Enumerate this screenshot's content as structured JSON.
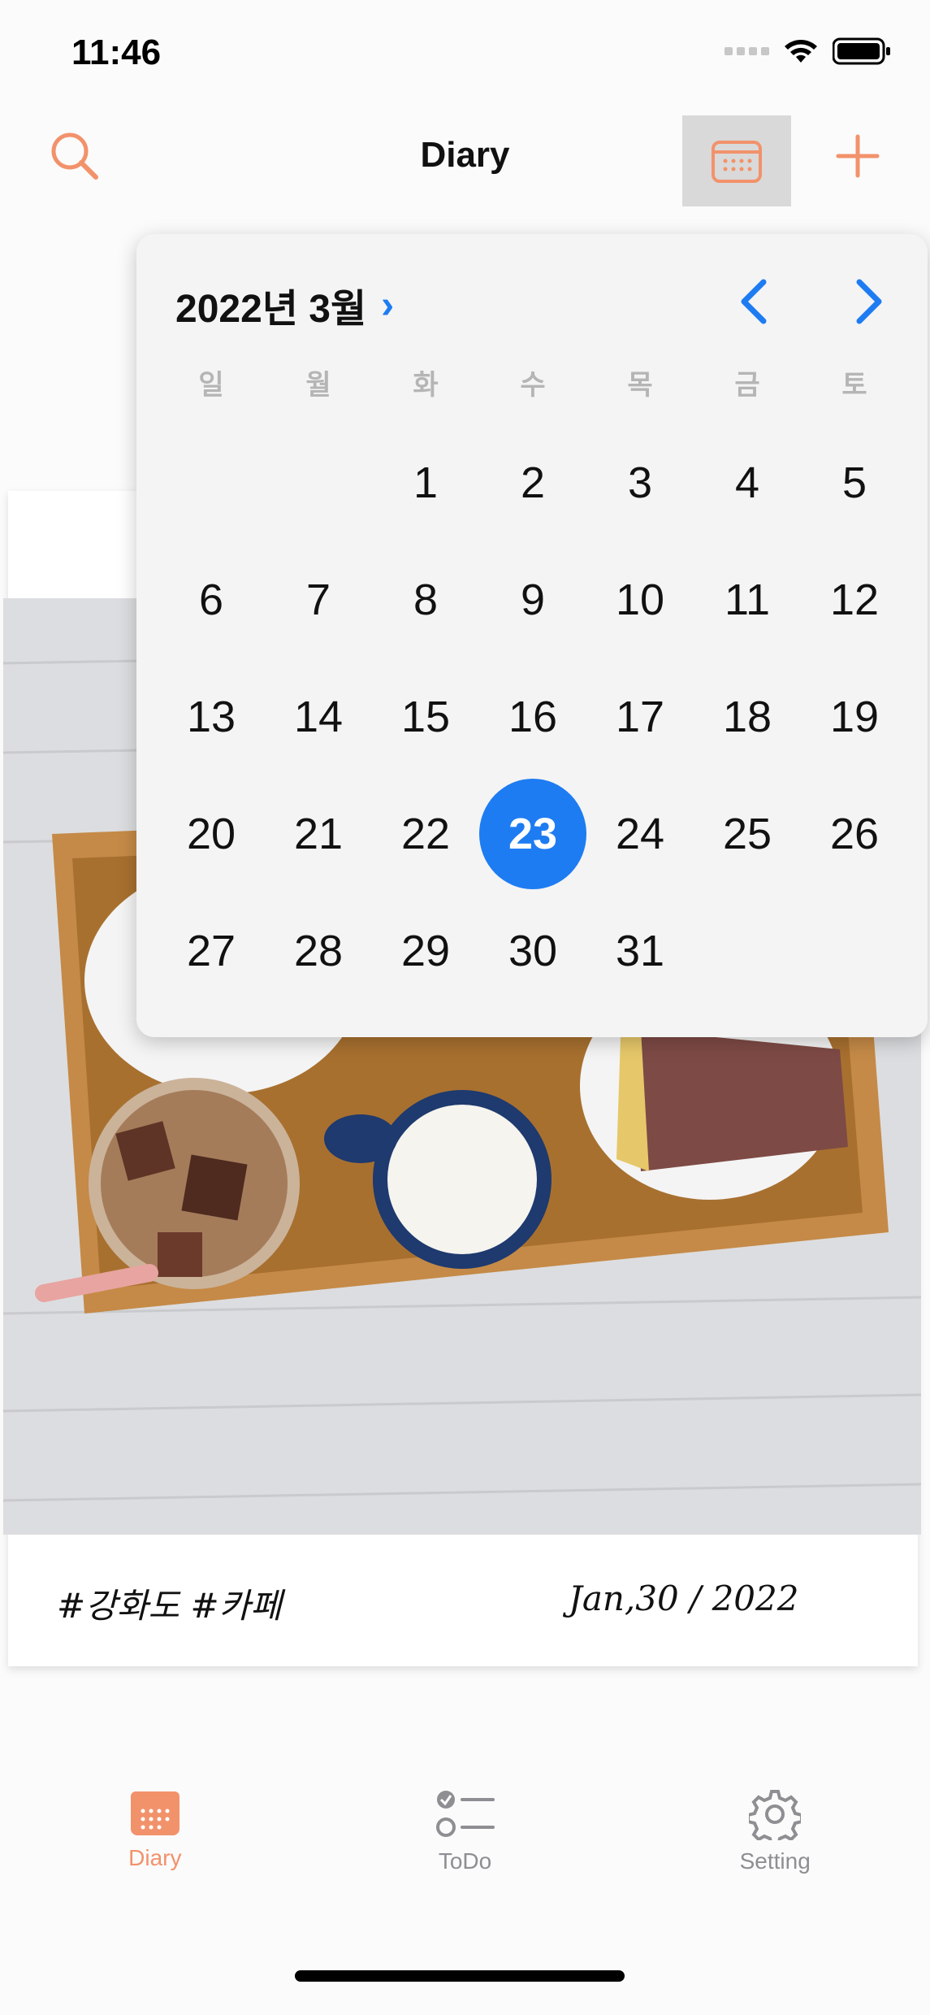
{
  "status_bar": {
    "time": "11:46"
  },
  "header": {
    "title": "Diary",
    "search_icon": "search-icon",
    "calendar_icon": "calendar-icon",
    "add_icon": "plus-icon"
  },
  "calendar": {
    "month_label": "2022년 3월",
    "weekdays": [
      "일",
      "월",
      "화",
      "수",
      "목",
      "금",
      "토"
    ],
    "days": [
      "",
      "",
      "1",
      "2",
      "3",
      "4",
      "5",
      "6",
      "7",
      "8",
      "9",
      "10",
      "11",
      "12",
      "13",
      "14",
      "15",
      "16",
      "17",
      "18",
      "19",
      "20",
      "21",
      "22",
      "23",
      "24",
      "25",
      "26",
      "27",
      "28",
      "29",
      "30",
      "31",
      "",
      "",
      ""
    ],
    "selected_day": "23"
  },
  "entry": {
    "tags": "#강화도 #카페",
    "date": "Jan,30 / 2022"
  },
  "tabbar": {
    "items": [
      {
        "label": "Diary",
        "icon": "calendar-icon",
        "active": true
      },
      {
        "label": "ToDo",
        "icon": "checklist-icon",
        "active": false
      },
      {
        "label": "Setting",
        "icon": "gear-icon",
        "active": false
      }
    ]
  },
  "colors": {
    "accent": "#f2926b",
    "calendar_blue": "#1e7cf2",
    "inactive": "#8e8e93"
  }
}
